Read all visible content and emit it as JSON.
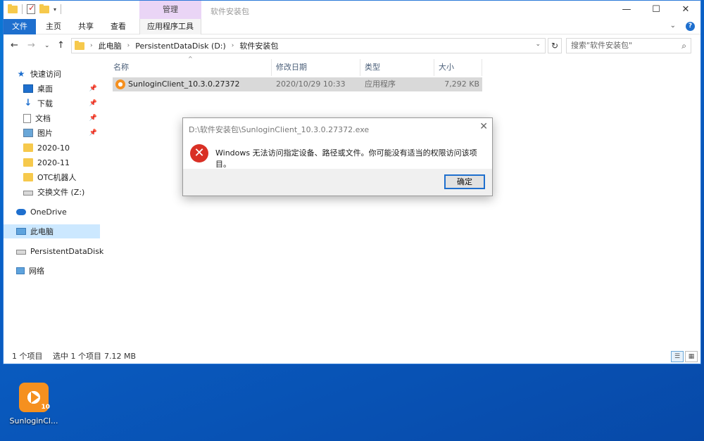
{
  "window": {
    "context_tab_title": "管理",
    "title": "软件安装包",
    "controls": {
      "minimize": "—",
      "maximize": "☐",
      "close": "✕"
    }
  },
  "ribbon": {
    "tabs": [
      "文件",
      "主页",
      "共享",
      "查看",
      "应用程序工具"
    ],
    "expand": "⌄",
    "help": "?"
  },
  "address": {
    "back": "←",
    "forward": "→",
    "dropdown": "⌄",
    "up": "↑",
    "crumbs": [
      "此电脑",
      "PersistentDataDisk (D:)",
      "软件安装包"
    ],
    "refresh": "↻",
    "search_placeholder": "搜索\"软件安装包\"",
    "search_icon": "⌕"
  },
  "nav": {
    "quick_access": "快速访问",
    "items": [
      {
        "label": "桌面",
        "pinned": true
      },
      {
        "label": "下载",
        "pinned": true
      },
      {
        "label": "文档",
        "pinned": true
      },
      {
        "label": "图片",
        "pinned": true
      },
      {
        "label": "2020-10"
      },
      {
        "label": "2020-11"
      },
      {
        "label": "OTC机器人"
      },
      {
        "label": "交换文件 (Z:)"
      }
    ],
    "onedrive": "OneDrive",
    "this_pc": "此电脑",
    "data_disk": "PersistentDataDisk",
    "network": "网络",
    "pin_glyph": "📌"
  },
  "columns": [
    "名称",
    "修改日期",
    "类型",
    "大小"
  ],
  "files": [
    {
      "name": "SunloginClient_10.3.0.27372",
      "date": "2020/10/29 10:33",
      "type": "应用程序",
      "size": "7,292 KB"
    }
  ],
  "status": {
    "count": "1 个项目",
    "selected": "选中 1 个项目",
    "size": "7.12 MB"
  },
  "dialog": {
    "title": "D:\\软件安装包\\SunloginClient_10.3.0.27372.exe",
    "close": "✕",
    "error_glyph": "✕",
    "message": "Windows 无法访问指定设备、路径或文件。你可能没有适当的权限访问该项目。",
    "ok": "确定"
  },
  "desktop": {
    "icon_label": "SunloginCl...",
    "icon_badge": "10"
  },
  "colors": {
    "accent": "#1e6fce",
    "context_tab": "#ead5f6",
    "selection": "#cce8ff",
    "error": "#d93025"
  }
}
